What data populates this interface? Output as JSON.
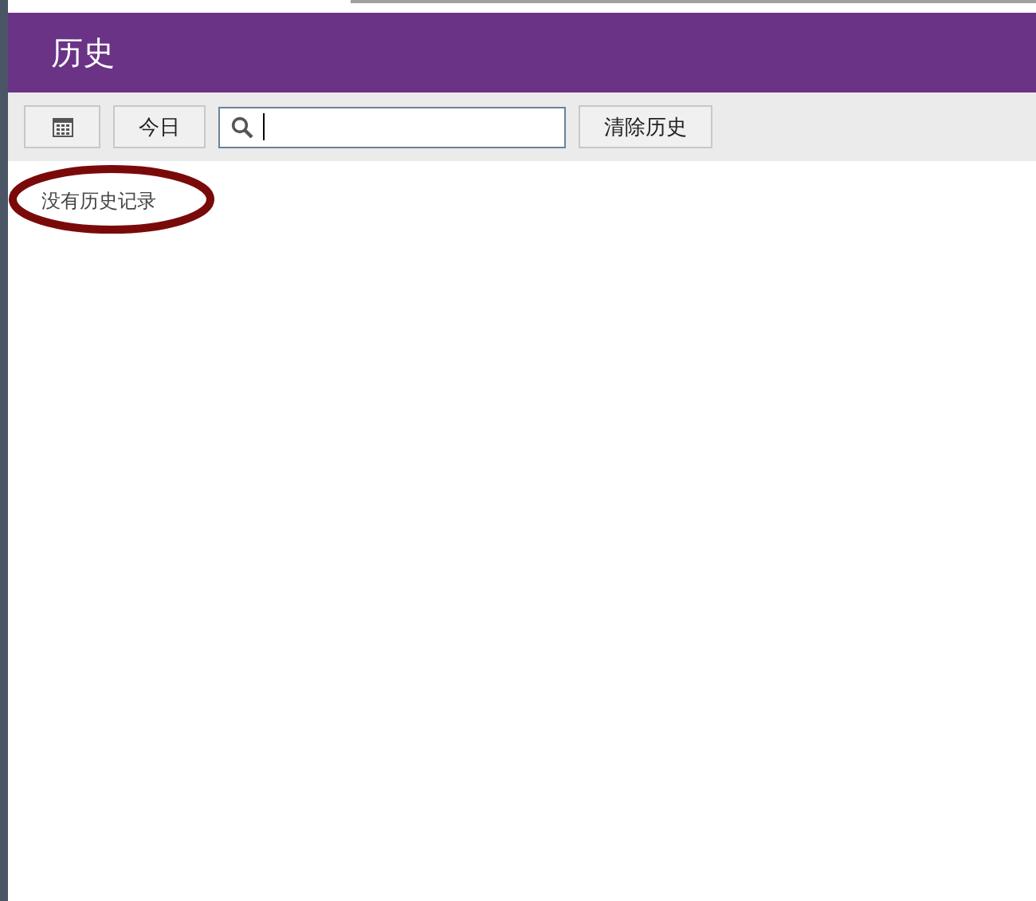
{
  "header": {
    "title": "历史"
  },
  "toolbar": {
    "today_button": "今日",
    "clear_button": "清除历史"
  },
  "content": {
    "empty_message": "没有历史记录",
    "highlighted": true
  }
}
